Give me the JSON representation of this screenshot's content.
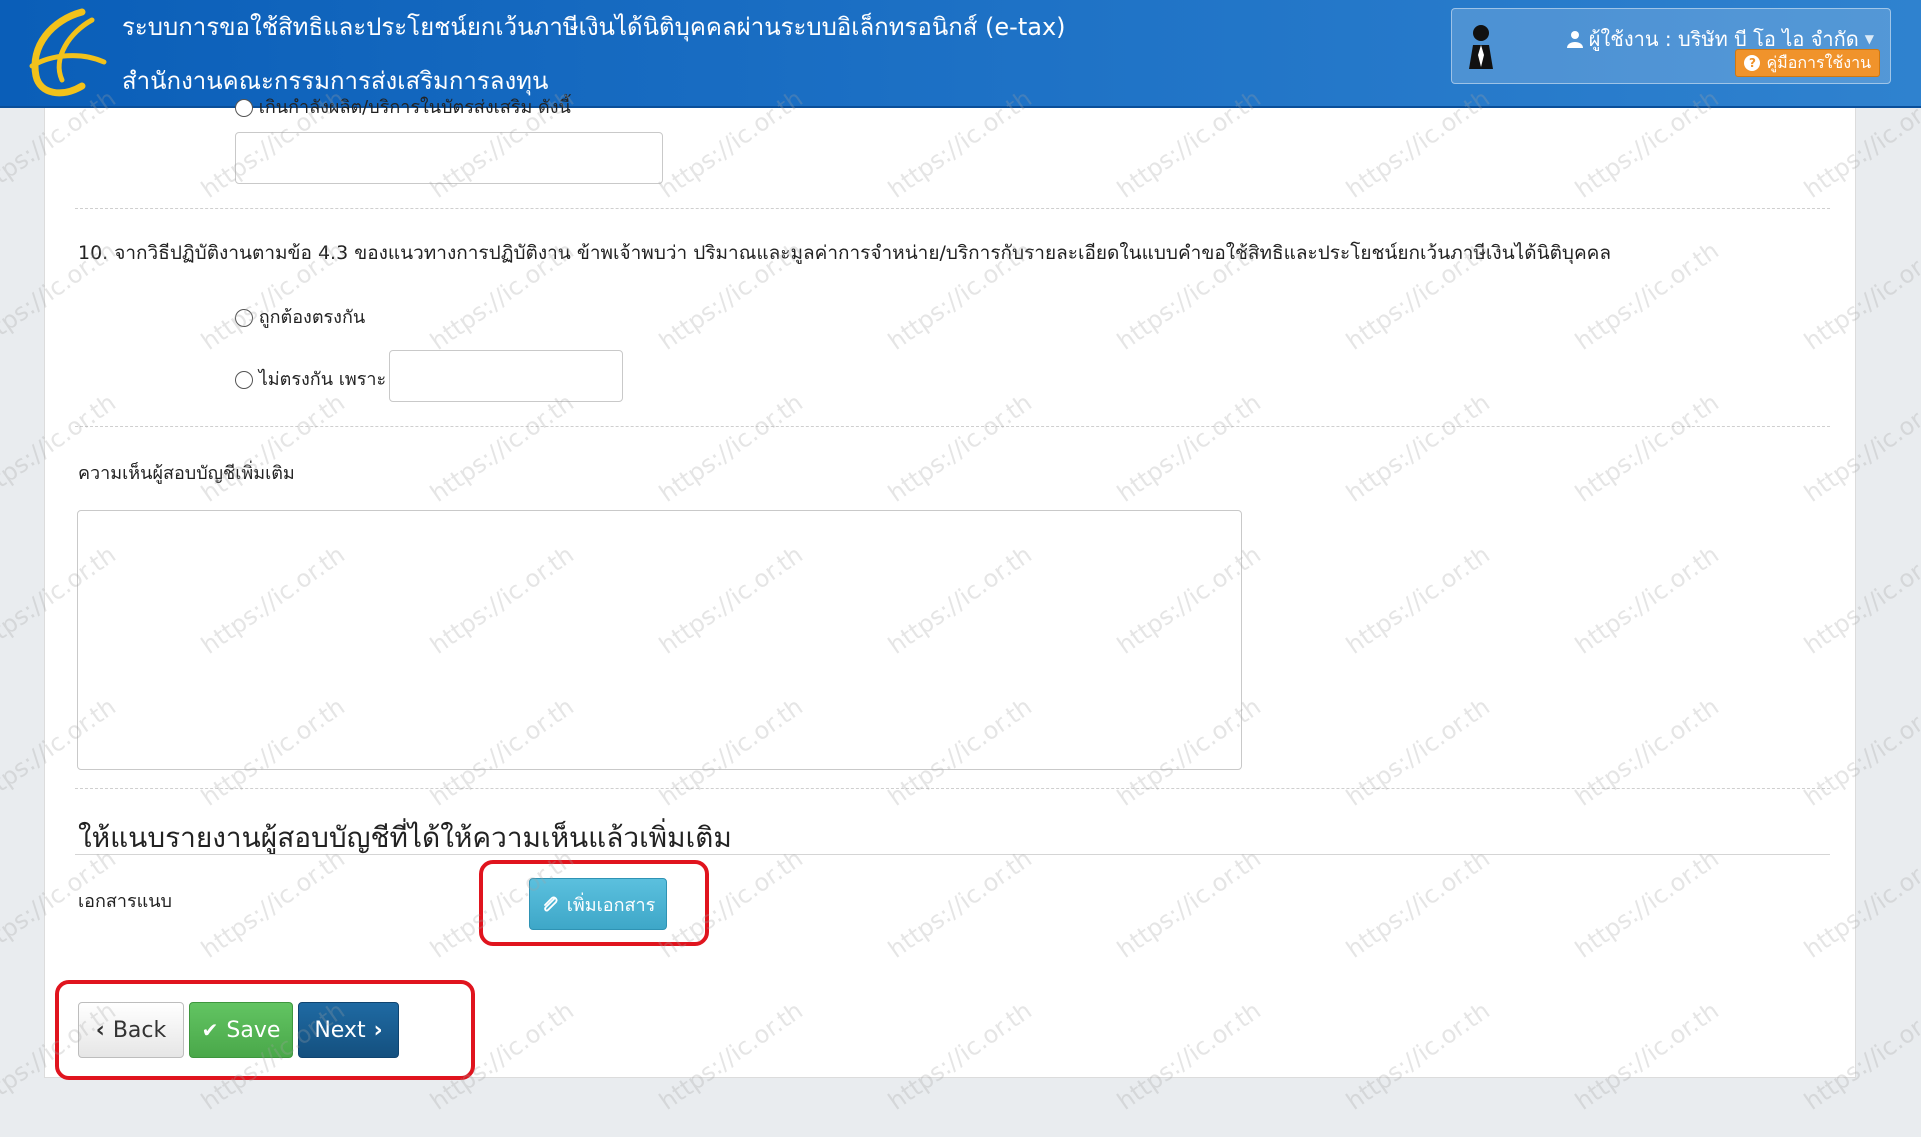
{
  "header": {
    "system_title": "ระบบการขอใช้สิทธิและประโยชน์ยกเว้นภาษีเงินได้นิติบุคคลผ่านระบบอิเล็กทรอนิกส์ (e-tax)",
    "org_title": "สำนักงานคณะกรรมการส่งเสริมการลงทุน",
    "user_label": "ผู้ใช้งาน : บริษัท บี โอ ไอ จำกัด",
    "manual_label": "คู่มือการใช้งาน",
    "colors": {
      "bar": "#1b6fc4",
      "manual_button": "#f0932b"
    }
  },
  "form": {
    "prev_option_label": "เกินกำลังผลิต/บริการในบัตรส่งเสริม ดังนี้",
    "q10_text": "10. จากวิธีปฏิบัติงานตามข้อ 4.3 ของแนวทางการปฏิบัติงาน ข้าพเจ้าพบว่า ปริมาณและมูลค่าการจำหน่าย/บริการกับรายละเอียดในแบบคำขอใช้สิทธิและประโยชน์ยกเว้นภาษีเงินได้นิติบุคคล",
    "q10_options": [
      "ถูกต้องตรงกัน",
      "ไม่ตรงกัน เพราะ"
    ],
    "auditor_opinion_label": "ความเห็นผู้สอบบัญชีเพิ่มเติม",
    "attach_section_title": "ให้แนบรายงานผู้สอบบัญชีที่ได้ให้ความเห็นแล้วเพิ่มเติม",
    "attachment_label": "เอกสารแนบ",
    "add_document_label": "เพิ่มเอกสาร"
  },
  "actions": {
    "back_label": "Back",
    "save_label": "Save",
    "next_label": "Next",
    "colors": {
      "save": "#5cb85c",
      "next": "#1a5e94",
      "highlight": "#e0141e"
    }
  },
  "watermark": {
    "text": "https://ic.or.th"
  }
}
